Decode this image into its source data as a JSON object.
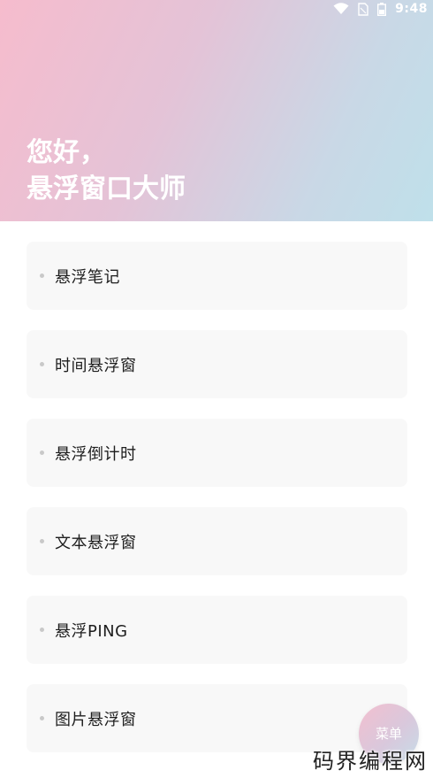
{
  "status_bar": {
    "time": "9:48",
    "icons": [
      "wifi-icon",
      "sim-icon",
      "battery-icon"
    ]
  },
  "header": {
    "line1": "您好，",
    "line2": "悬浮窗口大师",
    "gradient_colors": [
      "#f6bccd",
      "#bfe0ea"
    ]
  },
  "menu": {
    "items": [
      {
        "label": "悬浮笔记"
      },
      {
        "label": "时间悬浮窗"
      },
      {
        "label": "悬浮倒计时"
      },
      {
        "label": "文本悬浮窗"
      },
      {
        "label": "悬浮PING"
      },
      {
        "label": "图片悬浮窗"
      }
    ]
  },
  "fab": {
    "label": "菜单"
  },
  "watermark": {
    "text": "码界编程网"
  }
}
